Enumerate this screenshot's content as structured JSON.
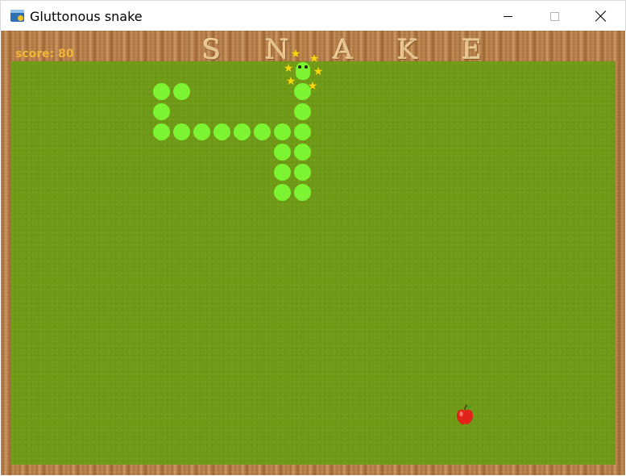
{
  "window": {
    "title": "Gluttonous snake",
    "icon": "python-app-icon",
    "controls": [
      "minimize-icon",
      "maximize-icon",
      "close-icon"
    ]
  },
  "game": {
    "banner": "S N A K E",
    "score_text": "score: 80",
    "score": 80,
    "colors": {
      "grass": "#6f9a15",
      "snake": "#7df431",
      "score": "#f2b53a",
      "banner": "#e6c38e",
      "stars": "#f5d90f",
      "apple": "#e2231a",
      "wood": "#c08a52"
    },
    "snake": {
      "length": 17,
      "head_decoration": "star-burst"
    },
    "food": "apple-icon"
  }
}
